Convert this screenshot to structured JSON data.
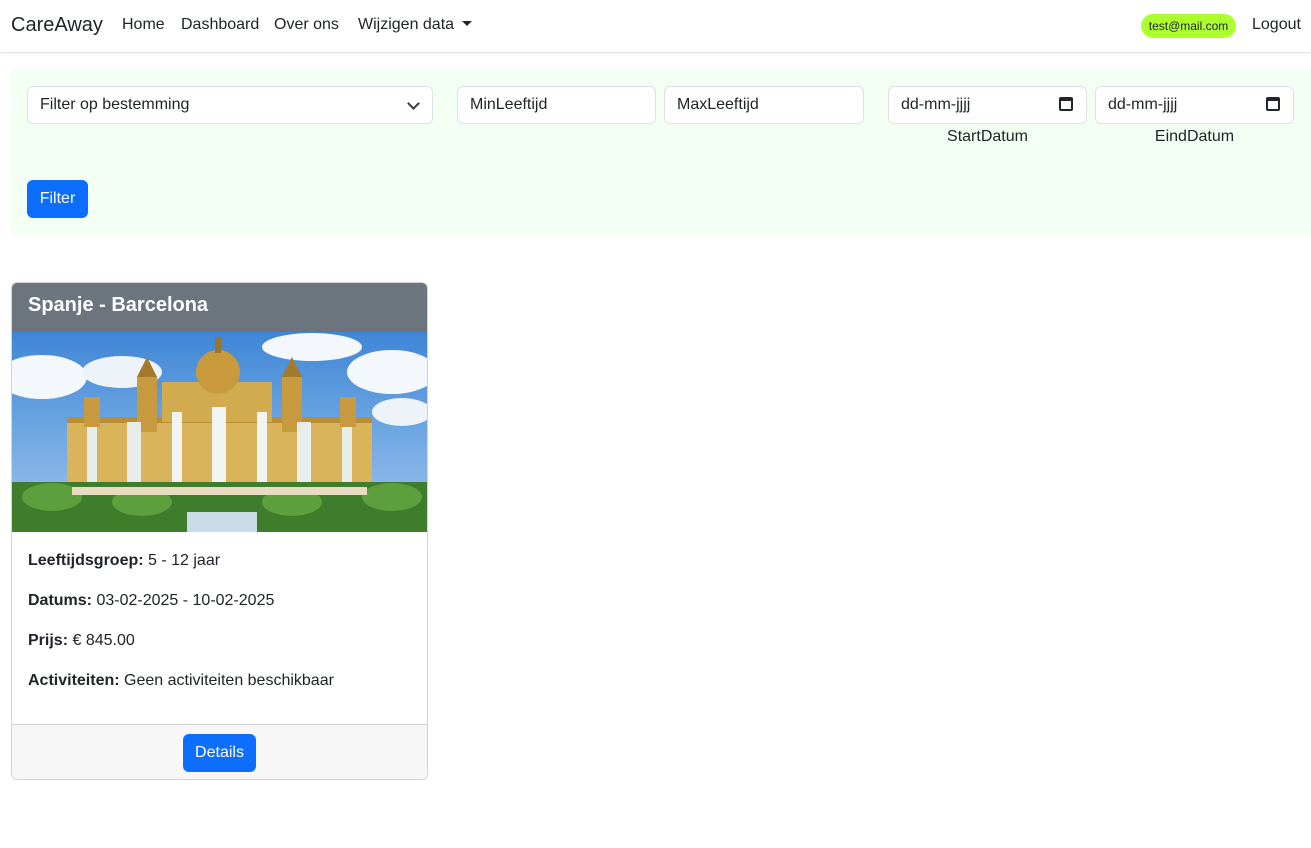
{
  "nav": {
    "brand": "CareAway",
    "links": [
      "Home",
      "Dashboard",
      "Over ons"
    ],
    "dropdown_label": "Wijzigen data",
    "user_email": "test@mail.com",
    "logout": "Logout"
  },
  "filter": {
    "destination_placeholder": "Filter op bestemming",
    "min_age_placeholder": "MinLeeftijd",
    "max_age_placeholder": "MaxLeeftijd",
    "start_date_value": "dd-mm-jjjj",
    "end_date_value": "dd-mm-jjjj",
    "start_date_label": "StartDatum",
    "end_date_label": "EindDatum",
    "button": "Filter"
  },
  "card": {
    "title": "Spanje - Barcelona",
    "age_label": "Leeftijdsgroep:",
    "age_value": "5 - 12 jaar",
    "dates_label": "Datums:",
    "dates_value": "03-02-2025 - 10-02-2025",
    "price_label": "Prijs:",
    "price_value": "€ 845.00",
    "activities_label": "Activiteiten:",
    "activities_value": "Geen activiteiten beschikbaar",
    "details_button": "Details"
  },
  "icons": {
    "dropdown": "caret-down-icon",
    "select": "chevron-down-icon",
    "date": "calendar-icon"
  },
  "colors": {
    "primary": "#0d6efd",
    "badge": "#adff2f",
    "filter_bg": "#f2fff2",
    "card_header": "#6c757d"
  }
}
